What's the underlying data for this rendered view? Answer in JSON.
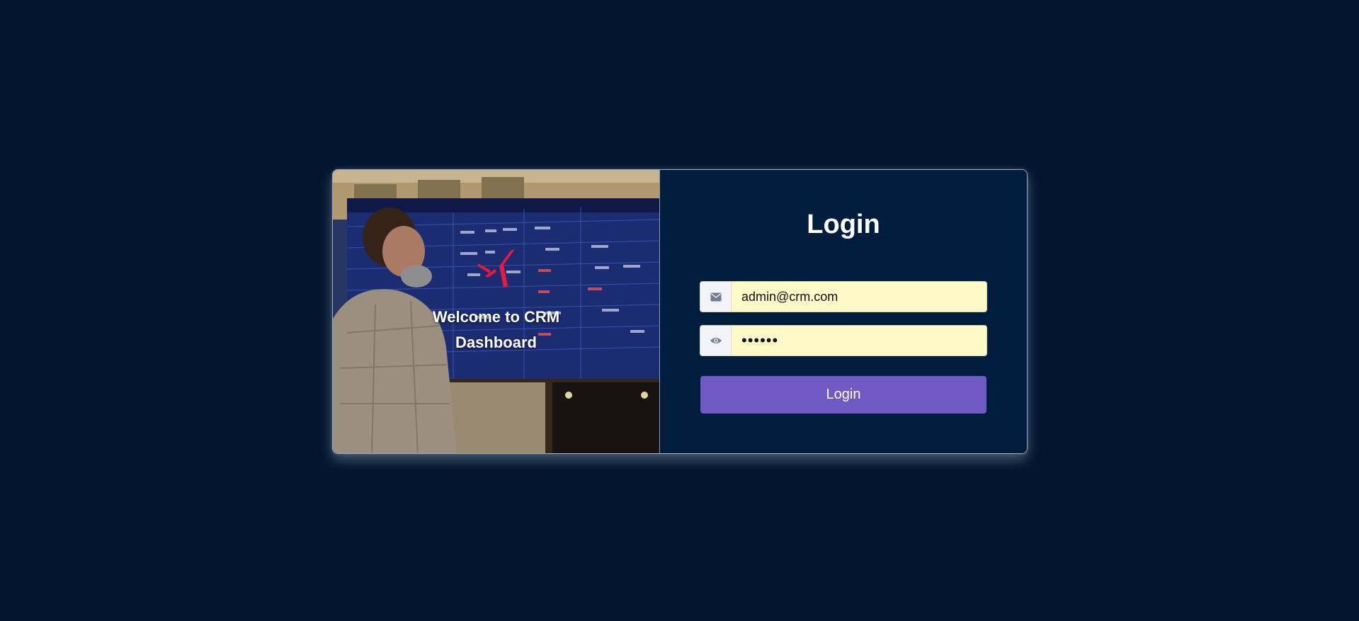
{
  "hero": {
    "welcome": "Welcome to CRM Dashboard"
  },
  "form": {
    "title": "Login",
    "email": {
      "value": "admin@crm.com",
      "icon": "envelope-icon"
    },
    "password": {
      "value": "••••••",
      "icon": "eye-icon"
    },
    "submit_label": "Login"
  },
  "colors": {
    "page_bg": "#01172f",
    "panel_bg": "#001d3e",
    "button": "#6f5ac4",
    "field_bg": "#fffac8",
    "logo": "#e8193c"
  }
}
